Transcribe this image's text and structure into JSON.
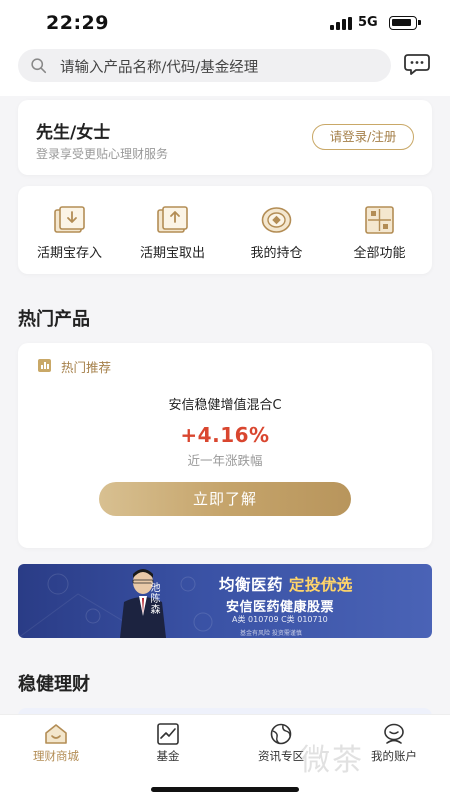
{
  "status_bar": {
    "time": "22:29",
    "network": "5G"
  },
  "search": {
    "placeholder": "请输入产品名称/代码/基金经理"
  },
  "icons": {
    "search": "search-icon",
    "message": "chat-bubble-icon",
    "deposit": "deposit-in-icon",
    "withdraw": "withdraw-out-icon",
    "holdings": "coin-icon",
    "all_functions": "grid-icon"
  },
  "login_card": {
    "title": "先生/女士",
    "subtitle": "登录享受更贴心理财服务",
    "button_label": "请登录/注册"
  },
  "quick_actions": [
    {
      "label": "活期宝存入",
      "icon": "deposit-in-icon"
    },
    {
      "label": "活期宝取出",
      "icon": "withdraw-out-icon"
    },
    {
      "label": "我的持仓",
      "icon": "coin-icon"
    },
    {
      "label": "全部功能",
      "icon": "grid-icon"
    }
  ],
  "hot_section": {
    "title": "热门产品",
    "tag": "热门推荐",
    "fund_name": "安信稳健增值混合C",
    "return_rate": "+4.16%",
    "return_label": "近一年涨跌幅",
    "cta": "立即了解"
  },
  "banner": {
    "manager_name": "池陈森",
    "title_part1": "均衡医药 ",
    "title_part2": "定投优选",
    "fund_title": "安信医药健康股票",
    "codes": "A类 010709 C类 010710",
    "disclaimer": "基金有风险 投资需谨慎"
  },
  "steady_section": {
    "title": "稳健理财"
  },
  "tabs": [
    {
      "label": "理财商城",
      "icon": "shop-icon",
      "active": true
    },
    {
      "label": "基金",
      "icon": "chart-icon",
      "active": false
    },
    {
      "label": "资讯专区",
      "icon": "globe-icon",
      "active": false
    },
    {
      "label": "我的账户",
      "icon": "user-icon",
      "active": false
    }
  ],
  "watermark": "微茶",
  "colors": {
    "accent_gold": "#b38d55",
    "rate_red": "#d9462f",
    "banner_blue": "#3a52a5",
    "banner_yellow": "#ffd569"
  }
}
